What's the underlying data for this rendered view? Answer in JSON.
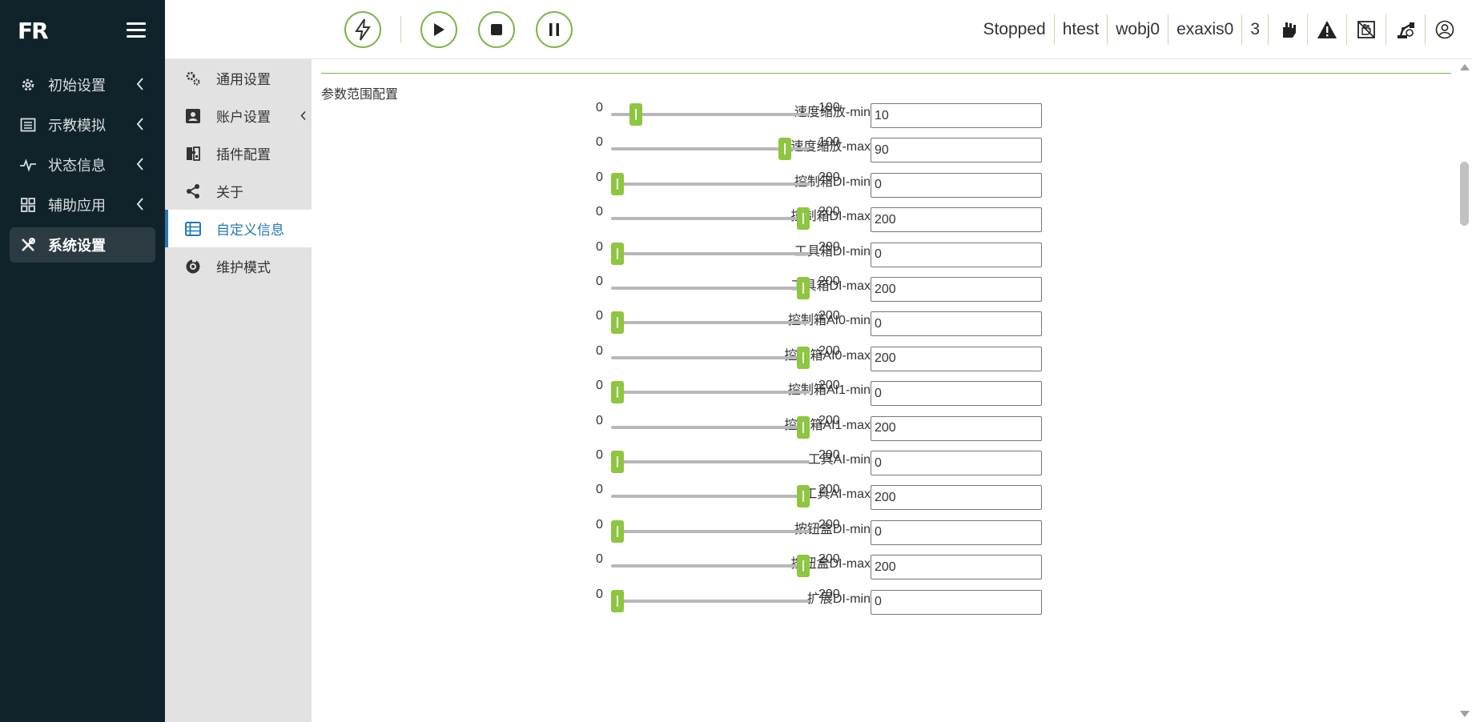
{
  "brand": {
    "logo_text": "FR"
  },
  "sidebar": {
    "items": [
      {
        "label": "初始设置",
        "icon": "gear-icon"
      },
      {
        "label": "示教模拟",
        "icon": "list-icon"
      },
      {
        "label": "状态信息",
        "icon": "pulse-icon"
      },
      {
        "label": "辅助应用",
        "icon": "grid-icon"
      },
      {
        "label": "系统设置",
        "icon": "tools-icon",
        "active": true
      }
    ]
  },
  "header": {
    "status": "Stopped",
    "program": "htest",
    "wobj": "wobj0",
    "exaxis": "exaxis0",
    "count": "3"
  },
  "submenu": {
    "items": [
      {
        "label": "通用设置"
      },
      {
        "label": "账户设置"
      },
      {
        "label": "插件配置"
      },
      {
        "label": "关于"
      },
      {
        "label": "自定义信息",
        "active": true
      },
      {
        "label": "维护模式"
      }
    ]
  },
  "main": {
    "section_title": "参数范围配置",
    "rows": [
      {
        "label": "速度缩放-min",
        "min": "0",
        "max": "100",
        "value": "10"
      },
      {
        "label": "速度缩放-max",
        "min": "0",
        "max": "100",
        "value": "90"
      },
      {
        "label": "控制箱DI-min",
        "min": "0",
        "max": "200",
        "value": "0"
      },
      {
        "label": "控制箱DI-max",
        "min": "0",
        "max": "200",
        "value": "200"
      },
      {
        "label": "工具箱DI-min",
        "min": "0",
        "max": "200",
        "value": "0"
      },
      {
        "label": "工具箱DI-max",
        "min": "0",
        "max": "200",
        "value": "200"
      },
      {
        "label": "控制箱AI0-min",
        "min": "0",
        "max": "200",
        "value": "0"
      },
      {
        "label": "控制箱AI0-max",
        "min": "0",
        "max": "200",
        "value": "200"
      },
      {
        "label": "控制箱AI1-min",
        "min": "0",
        "max": "200",
        "value": "0"
      },
      {
        "label": "控制箱AI1-max",
        "min": "0",
        "max": "200",
        "value": "200"
      },
      {
        "label": "工具AI-min",
        "min": "0",
        "max": "200",
        "value": "0"
      },
      {
        "label": "工具AI-max",
        "min": "0",
        "max": "200",
        "value": "200"
      },
      {
        "label": "按钮盒DI-min",
        "min": "0",
        "max": "200",
        "value": "0"
      },
      {
        "label": "按钮盒DI-max",
        "min": "0",
        "max": "200",
        "value": "200"
      },
      {
        "label": "扩展DI-min",
        "min": "0",
        "max": "200",
        "value": "0"
      }
    ]
  },
  "colors": {
    "accent": "#8dc63f",
    "sidebar_bg": "#10232b",
    "active_link": "#2479b3"
  }
}
